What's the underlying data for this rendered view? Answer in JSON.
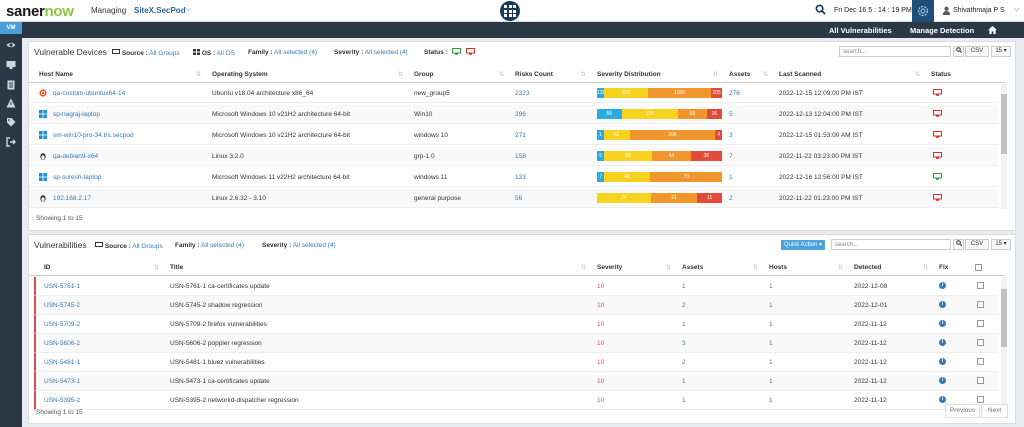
{
  "header": {
    "logo_prefix": "saner",
    "logo_suffix": "now",
    "managing_label": "Managing",
    "site_name": "SiteX.SecPod",
    "datetime": "Fri Dec 16  5 : 14 : 19 PM",
    "user_name": "Shivathmaja P S"
  },
  "sidebar": {
    "active_label": "VM",
    "icons": [
      "eye-icon",
      "monitor-icon",
      "document-icon",
      "warning-icon",
      "tag-icon",
      "logout-icon"
    ]
  },
  "nav": {
    "all_vulnerabilities": "All Vulnerabilities",
    "manage_detection": "Manage Detection"
  },
  "devices": {
    "title": "Vulnerable Devices",
    "filters": {
      "source_label": "Source :",
      "source_value": "All Groups",
      "os_label": "OS :",
      "os_value": "All OS",
      "family_label": "Family :",
      "family_value": "All selected (4)",
      "severity_label": "Severity :",
      "severity_value": "All selected (4)",
      "status_label": "Status :"
    },
    "search_placeholder": "search...",
    "csv_label": "CSV",
    "page_size": "15",
    "columns": [
      "Host Name",
      "Operating System",
      "Group",
      "Risks Count",
      "Severity Distribution",
      "Assets",
      "Last Scanned",
      "Status"
    ],
    "rows": [
      {
        "host": "qa-custom-ubuntux64-14",
        "os": "Ubuntu v18.04 architecture x86_64",
        "group": "new_group5",
        "risks": "2323",
        "sev": [
          "128",
          "810",
          "1180",
          "205"
        ],
        "assets": "276",
        "scanned": "2022-12-15 12:09:00 PM IST",
        "os_type": "ubuntu",
        "status": "offline"
      },
      {
        "host": "sp-nagraj-laptop",
        "os": "Microsoft Windows 10 v21H2 architecture 64-bit",
        "group": "Win10",
        "risks": "296",
        "sev": [
          "58",
          "134",
          "68",
          "36"
        ],
        "assets": "5",
        "scanned": "2022-12-13 12:04:00 PM IST",
        "os_type": "windows",
        "status": "offline"
      },
      {
        "host": "vm-win10-pro-34.trs.secpod",
        "os": "Microsoft Windows 10 v21H2 architecture 64-bit",
        "group": "windows 10",
        "risks": "271",
        "sev": [
          "1",
          "62",
          "206",
          "4"
        ],
        "assets": "3",
        "scanned": "2022-12-15 01:53:00 AM IST",
        "os_type": "windows",
        "status": "offline"
      },
      {
        "host": "qa-debian9-x64",
        "os": "Linux 3.2.0",
        "group": "grp-1.0",
        "risks": "158",
        "sev": [
          "5",
          "55",
          "44",
          "36"
        ],
        "assets": "7",
        "scanned": "2022-11-22 03:23:00 PM IST",
        "os_type": "linux",
        "status": "offline"
      },
      {
        "host": "sp-suresh-laptop",
        "os": "Microsoft Windows 11 v22H2 architecture 64-bit",
        "group": "windows 11",
        "risks": "133",
        "sev": [
          "7",
          "45",
          "70",
          ""
        ],
        "assets": "1",
        "scanned": "2022-12-16 12:56:00 PM IST",
        "os_type": "windows",
        "status": "online"
      },
      {
        "host": "192.168.2.17",
        "os": "Linux 2.6.32 - 3.10",
        "group": "general purpose",
        "risks": "56",
        "sev": [
          "",
          "24",
          "21",
          "11"
        ],
        "assets": "2",
        "scanned": "2022-11-22 01:23:00 PM IST",
        "os_type": "linux",
        "status": "offline"
      }
    ],
    "showing": "Showing 1 to 15"
  },
  "vulns": {
    "title": "Vulnerabilities",
    "filters": {
      "source_label": "Source :",
      "source_value": "All Groups",
      "family_label": "Family :",
      "family_value": "All selected (4)",
      "severity_label": "Severity :",
      "severity_value": "All selected (4)"
    },
    "quick_action": "Quick Action",
    "search_placeholder": "search...",
    "csv_label": "CSV",
    "page_size": "15",
    "columns": [
      "ID",
      "Title",
      "Severity",
      "Assets",
      "Hosts",
      "Detected",
      "Fix"
    ],
    "rows": [
      {
        "id": "USN-5761-1",
        "title": "USN-5761-1 ca-certificates update",
        "severity": "10",
        "assets": "1",
        "hosts": "1",
        "detected": "2022-12-08"
      },
      {
        "id": "USN-5745-2",
        "title": "USN-5745-2 shadow regression",
        "severity": "10",
        "assets": "2",
        "hosts": "1",
        "detected": "2022-12-01"
      },
      {
        "id": "USN-5709-2",
        "title": "USN-5709-2 firefox vulnerabilities",
        "severity": "10",
        "assets": "1",
        "hosts": "1",
        "detected": "2022-11-12"
      },
      {
        "id": "USN-5606-2",
        "title": "USN-5606-2 poppler regression",
        "severity": "10",
        "assets": "3",
        "hosts": "1",
        "detected": "2022-11-12"
      },
      {
        "id": "USN-5481-1",
        "title": "USN-5481-1 bluez vulnerabilities",
        "severity": "10",
        "assets": "2",
        "hosts": "1",
        "detected": "2022-11-12"
      },
      {
        "id": "USN-5473-1",
        "title": "USN-5473-1 ca-certificates update",
        "severity": "10",
        "assets": "1",
        "hosts": "1",
        "detected": "2022-11-12"
      },
      {
        "id": "USN-5395-2",
        "title": "USN-5395-2 networkd-dispatcher regression",
        "severity": "10",
        "assets": "1",
        "hosts": "1",
        "detected": "2022-11-12"
      }
    ],
    "showing": "Showing 1 to 15",
    "previous": "Previous",
    "next": "Next"
  },
  "colors": {
    "low": "#29abe2",
    "medium": "#f7d21e",
    "high": "#f0962d",
    "critical": "#e04b3a",
    "accent": "#337ab7",
    "online": "#2e9d3a",
    "offline": "#d9302c"
  }
}
